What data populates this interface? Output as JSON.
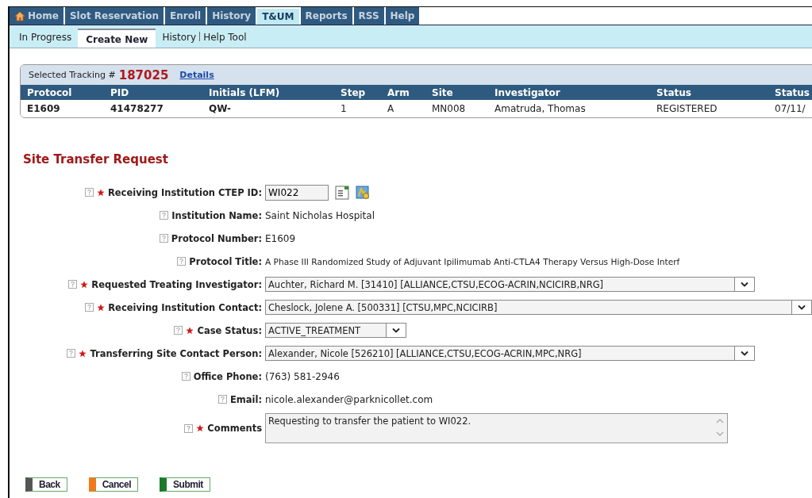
{
  "nav_tabs": [
    {
      "label": "Home",
      "kind": "home",
      "selected": false
    },
    {
      "label": "Slot Reservation",
      "kind": "text",
      "selected": false
    },
    {
      "label": "Enroll",
      "kind": "text",
      "selected": false
    },
    {
      "label": "History",
      "kind": "text",
      "selected": false
    },
    {
      "label": "T&UM",
      "kind": "text",
      "selected": true
    },
    {
      "label": "Reports",
      "kind": "text",
      "selected": false
    },
    {
      "label": "RSS",
      "kind": "text",
      "selected": false
    },
    {
      "label": "Help",
      "kind": "text",
      "selected": false
    }
  ],
  "sub_tabs": [
    {
      "label": "In Progress",
      "selected": false
    },
    {
      "label": "Create New",
      "selected": true
    },
    {
      "label": "History",
      "selected": false
    },
    {
      "label": "Help Tool",
      "selected": false
    }
  ],
  "tracking": {
    "label": "Selected Tracking #",
    "number": "187025",
    "link": "Details",
    "columns": [
      "Protocol",
      "PID",
      "Initials (LFM)",
      "Step",
      "Arm",
      "Site",
      "Investigator",
      "Status",
      "Status"
    ],
    "row": [
      {
        "text": "E1609",
        "bold": true
      },
      {
        "text": "41478277",
        "bold": true
      },
      {
        "text": "QW-",
        "bold": true
      },
      {
        "text": "1",
        "bold": false
      },
      {
        "text": "A",
        "bold": false
      },
      {
        "text": "MN008",
        "bold": false
      },
      {
        "text": "Amatruda, Thomas",
        "bold": false
      },
      {
        "text": "REGISTERED",
        "bold": false
      },
      {
        "text": "07/11/",
        "bold": false
      }
    ]
  },
  "form": {
    "title": "Site Transfer Request",
    "fields": [
      {
        "label": "Receiving Institution CTEP ID:",
        "kind": "lookup",
        "required": true,
        "value": "WI022"
      },
      {
        "label": "Institution Name:",
        "kind": "text",
        "required": false,
        "value": "Saint Nicholas Hospital"
      },
      {
        "label": "Protocol Number:",
        "kind": "text",
        "required": false,
        "value": "E1609"
      },
      {
        "label": "Protocol Title:",
        "kind": "text",
        "required": false,
        "value": "A Phase III Randomized Study of Adjuvant Ipilimumab Anti-CTLA4 Therapy Versus High-Dose Interf"
      },
      {
        "label": "Requested Treating Investigator:",
        "kind": "select",
        "required": true,
        "value": "Auchter, Richard M. [31410] [ALLIANCE,CTSU,ECOG-ACRIN,NCICIRB,NRG]"
      },
      {
        "label": "Receiving Institution Contact:",
        "kind": "select-wide",
        "required": true,
        "value": "Cheslock, Jolene A. [500331] [CTSU,MPC,NCICIRB]"
      },
      {
        "label": "Case Status:",
        "kind": "select-small",
        "required": true,
        "value": "ACTIVE_TREATMENT"
      },
      {
        "label": "Transferring Site Contact Person:",
        "kind": "select",
        "required": true,
        "value": "Alexander, Nicole [526210] [ALLIANCE,CTSU,ECOG-ACRIN,MPC,NRG]"
      },
      {
        "label": "Office Phone:",
        "kind": "text",
        "required": false,
        "value": "(763) 581-2946"
      },
      {
        "label": "Email:",
        "kind": "text",
        "required": false,
        "value": "nicole.alexander@parknicollet.com"
      },
      {
        "label": "Comments",
        "kind": "textarea",
        "required": true,
        "value": "Requesting to transfer the patient to WI022."
      }
    ]
  },
  "buttons": [
    {
      "label": "Back",
      "color": "#555555"
    },
    {
      "label": "Cancel",
      "color": "#f07a1a"
    },
    {
      "label": "Submit",
      "color": "#1a7a2a"
    }
  ]
}
